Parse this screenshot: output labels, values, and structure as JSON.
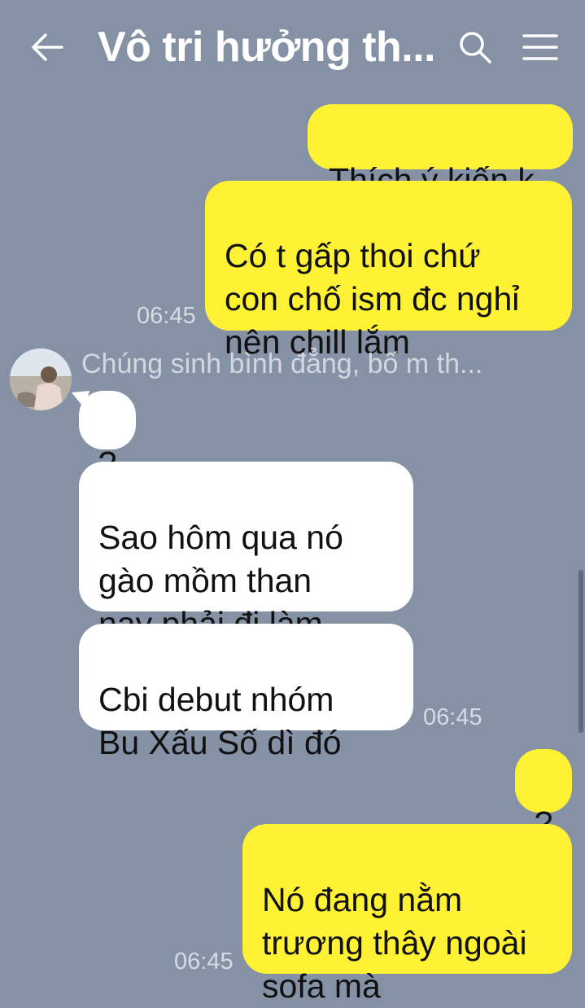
{
  "header": {
    "title": "Vô tri hưởng th...",
    "back_icon": "back-arrow-icon",
    "search_icon": "search-icon",
    "menu_icon": "hamburger-menu-icon"
  },
  "colors": {
    "background": "#8591a4",
    "outgoing_bubble": "#fff234",
    "incoming_bubble": "#ffffff"
  },
  "messages": {
    "m1": {
      "text": "Thích ý kiến k",
      "direction": "outgoing"
    },
    "m2": {
      "text": "Có t gấp thoi chứ\ncon chố ism đc nghỉ\nnên chill lắm",
      "direction": "outgoing",
      "time": "06:45"
    },
    "sender": {
      "name": "Chúng sinh bình đẳng, bố m th..."
    },
    "m3": {
      "text": "?",
      "direction": "incoming"
    },
    "m4": {
      "text": "Sao hôm qua nó\ngào mồm than\nnay phải đi làm",
      "direction": "incoming"
    },
    "m5": {
      "text": "Cbi debut nhóm\nBu Xấu Số dì đó",
      "direction": "incoming",
      "time": "06:45"
    },
    "m6": {
      "text": "?",
      "direction": "outgoing"
    },
    "m7": {
      "text": "Nó đang nằm\ntrương thây ngoài\nsofa mà",
      "direction": "outgoing",
      "time": "06:45"
    }
  }
}
